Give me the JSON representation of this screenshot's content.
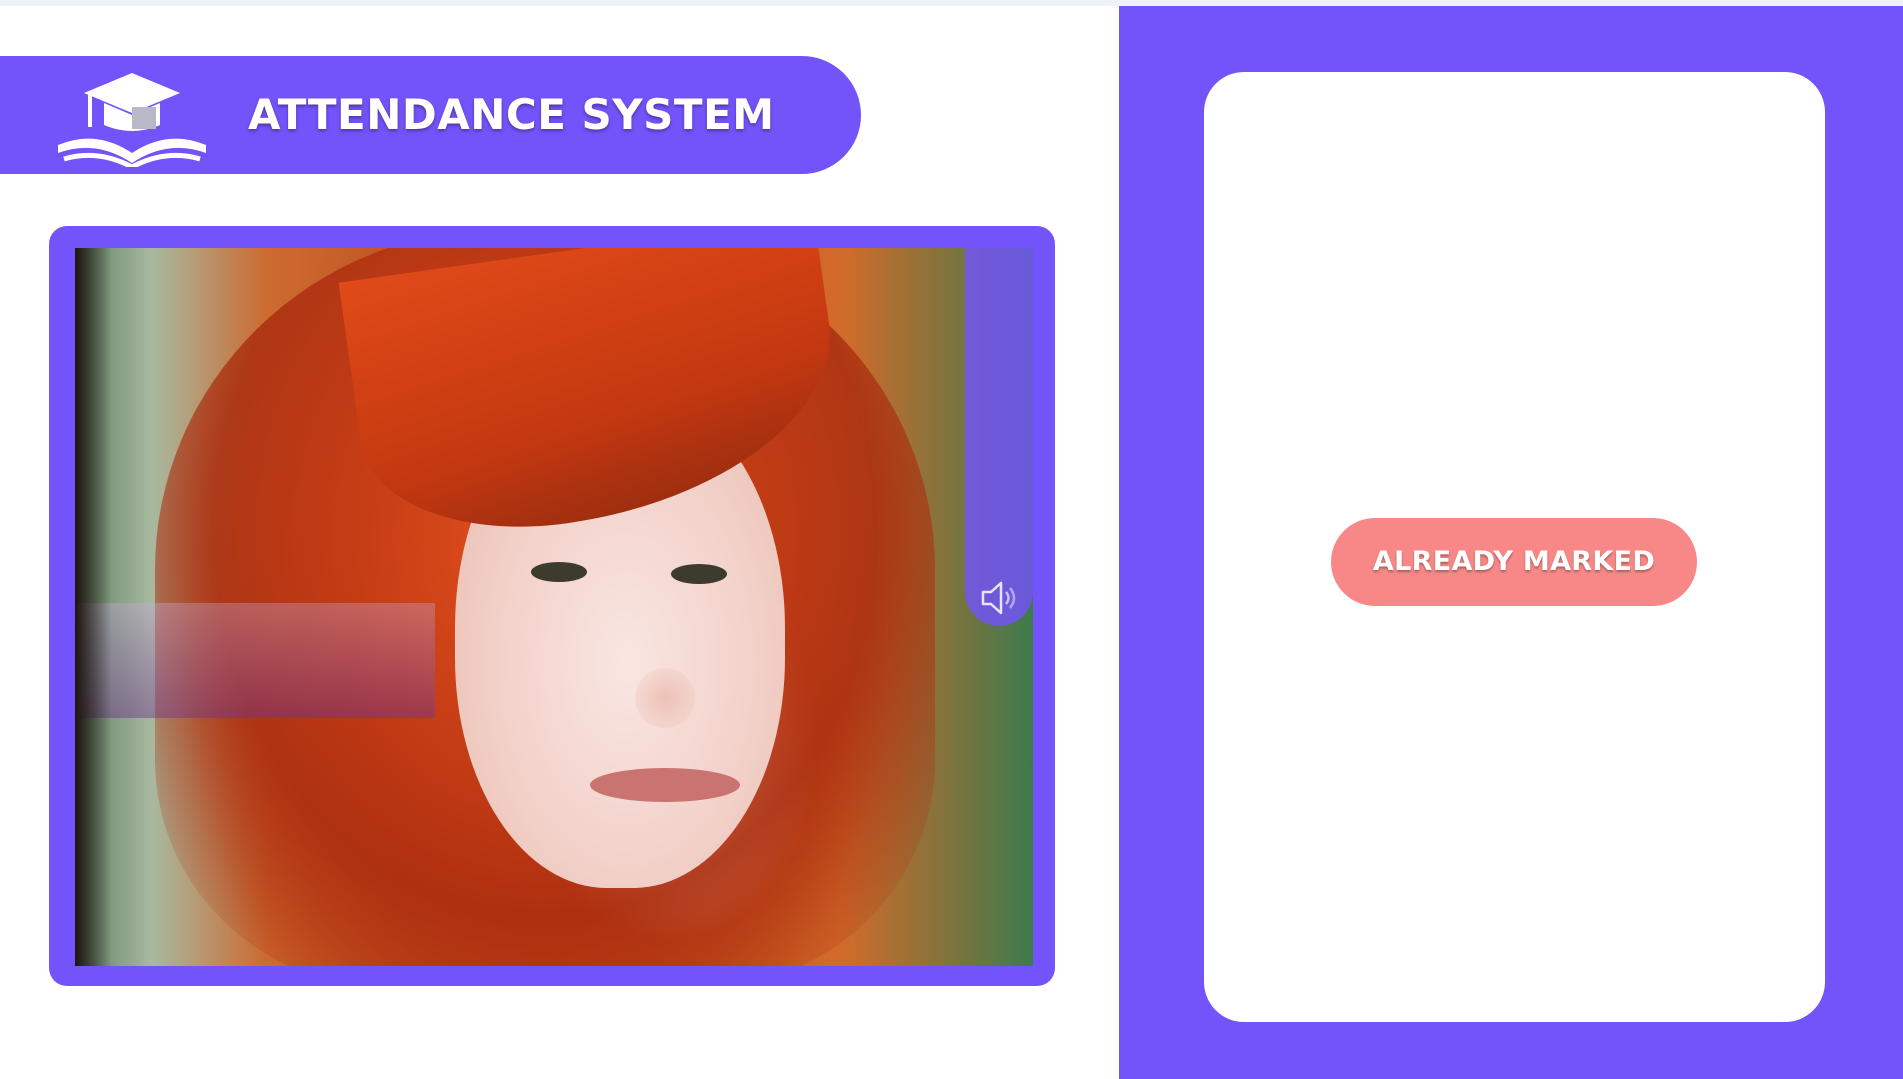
{
  "header": {
    "title": "ATTENDANCE SYSTEM",
    "logo_icon": "graduation-cap-book-icon"
  },
  "camera": {
    "audio_icon": "speaker-icon"
  },
  "status": {
    "label": "ALREADY MARKED",
    "color": "#f78887"
  },
  "theme": {
    "accent": "#7353fa",
    "card_background": "#ffffff"
  }
}
